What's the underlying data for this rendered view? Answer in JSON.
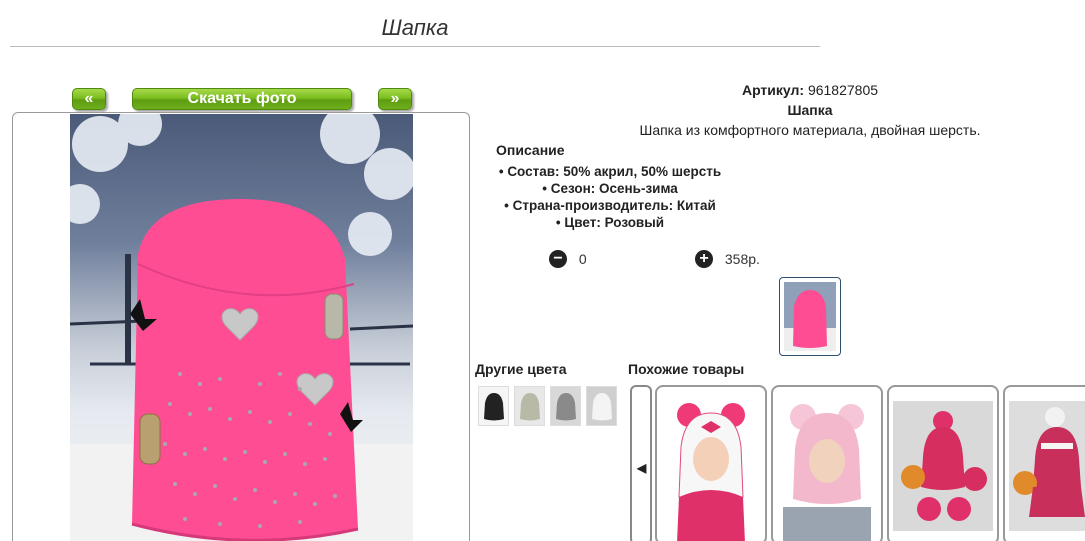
{
  "page": {
    "title": "Шапка"
  },
  "gallery": {
    "prev_label": "«",
    "download_label": "Скачать фото",
    "next_label": "»"
  },
  "product": {
    "article_label": "Артикул:",
    "article_value": "961827805",
    "name": "Шапка",
    "description": "Шапка из комфортного материала, двойная шерсть.",
    "description_heading": "Описание",
    "specs": [
      "Состав: 50% акрил, 50% шерсть",
      "Сезон: Осень-зима",
      "Страна-производитель: Китай",
      "Цвет: Розовый"
    ],
    "quantity": "0",
    "price": "358р.",
    "color_hex": "#ff4d94"
  },
  "other_colors": {
    "label": "Другие цвета",
    "swatches": [
      "black",
      "light-gray",
      "gray",
      "white"
    ]
  },
  "similar": {
    "label": "Похожие товары",
    "arrow": "◀"
  }
}
